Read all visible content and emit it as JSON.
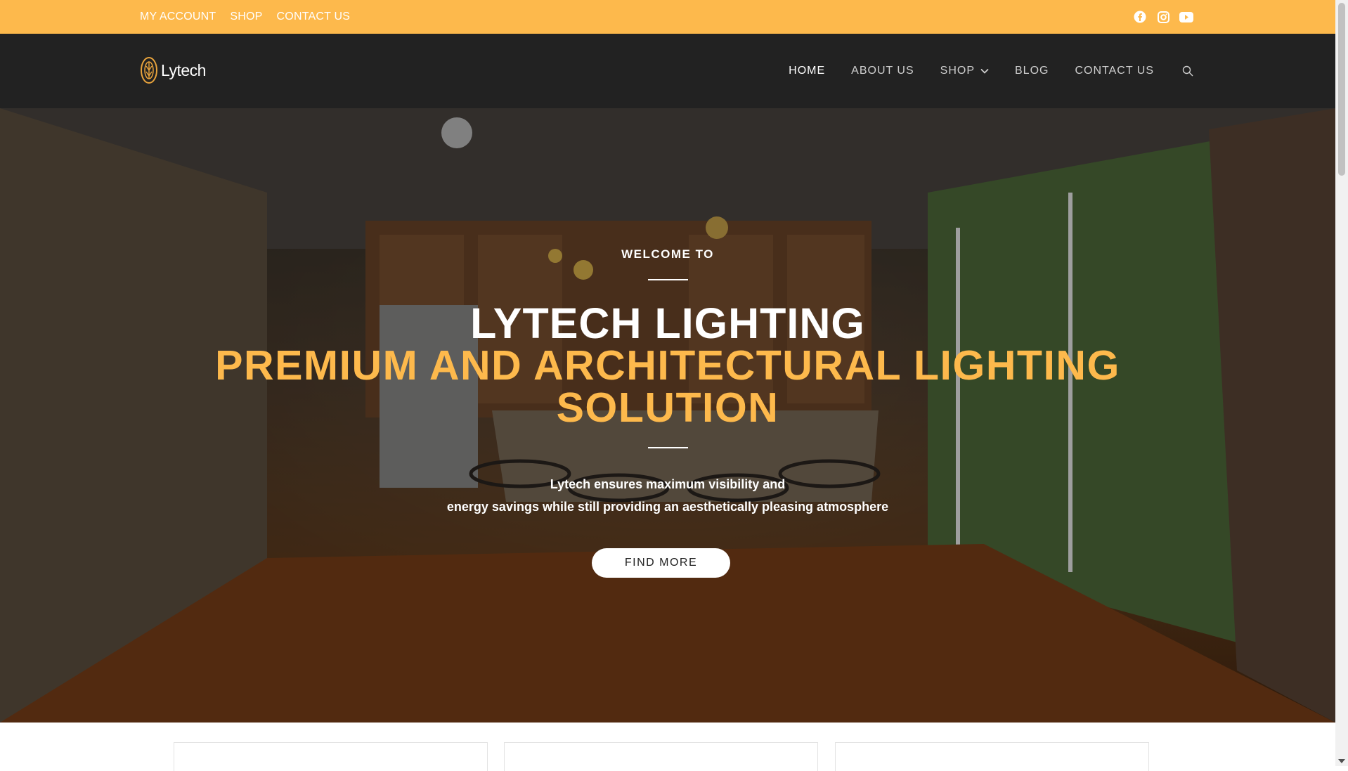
{
  "topbar": {
    "links": [
      "MY ACCOUNT",
      "SHOP",
      "CONTACT US"
    ],
    "social_icons": [
      "facebook-icon",
      "instagram-icon",
      "youtube-icon"
    ]
  },
  "header": {
    "logo_text": "Lytech",
    "nav": [
      {
        "label": "HOME",
        "active": true
      },
      {
        "label": "ABOUT US",
        "active": false
      },
      {
        "label": "SHOP",
        "active": false,
        "dropdown": true
      },
      {
        "label": "BLOG",
        "active": false
      },
      {
        "label": "CONTACT US",
        "active": false
      }
    ],
    "search_icon": "search-icon"
  },
  "hero": {
    "welcome": "WELCOME TO",
    "title": "LYTECH LIGHTING",
    "tagline_line1": "PREMIUM AND ARCHITECTURAL LIGHTING",
    "tagline_line2": "SOLUTION",
    "description_line1": "Lytech ensures maximum visibility and",
    "description_line2": "energy savings while still providing an aesthetically pleasing atmosphere",
    "cta_label": "FIND MORE"
  },
  "colors": {
    "accent": "#FDB94C",
    "nav_bg": "#222222",
    "text_light": "#ffffff"
  }
}
